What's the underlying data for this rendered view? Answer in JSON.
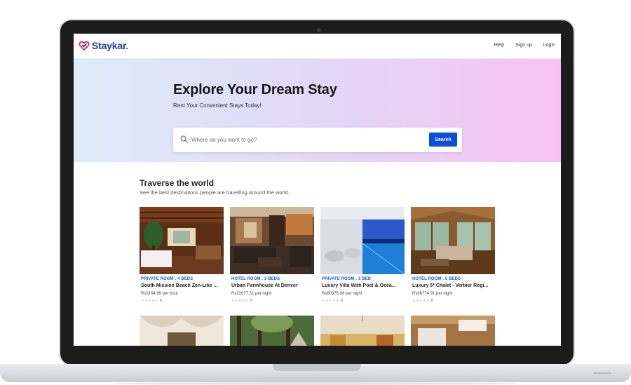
{
  "brand": {
    "name": "Staykar",
    "dot": ".",
    "primary": "#1c3faa",
    "accent": "#e0245e"
  },
  "nav": {
    "help": "Help",
    "signup": "Sign up",
    "login": "Login"
  },
  "hero": {
    "title": "Explore Your Dream Stay",
    "subtitle": "Rent Your Convenient Stays Today!",
    "search_placeholder": "Where do you want to go?",
    "search_button": "Search"
  },
  "section": {
    "title": "Traverse the world",
    "subtitle": "See the best destinations people are travelling around the world."
  },
  "listings": [
    {
      "tag": "PRIVATE ROOM . 4 BEDS",
      "name": "South Mission Beach Zen-Like ...",
      "price": "Rs3164.99 per hour",
      "rating_count": "0",
      "stars": "★★★★★"
    },
    {
      "tag": "HOTEL ROOM . 3 BEDS",
      "name": "Urban Farmhouse At Denver",
      "price": "Rs22677.51 per night",
      "rating_count": "0",
      "stars": "★★★★★"
    },
    {
      "tag": "PRIVATE ROOM . 1 BED",
      "name": "Luxury Villa With Pool & Ocea...",
      "price": "Rs60376.06 per night",
      "rating_count": "0",
      "stars": "★★★★★"
    },
    {
      "tag": "HOTEL ROOM . 5 BEDS",
      "name": "Luxury 5* Chalet - Verbier Regi...",
      "price": "Rs88774.91 per night",
      "rating_count": "0",
      "stars": "★★★★★"
    }
  ],
  "colors": {
    "button": "#0b4fd8",
    "tag": "#1a5cd6"
  }
}
